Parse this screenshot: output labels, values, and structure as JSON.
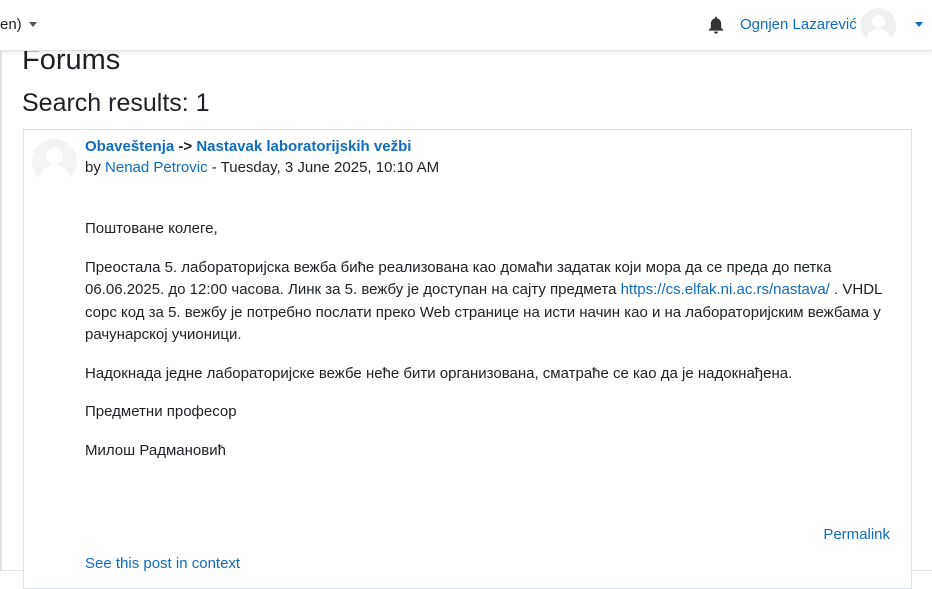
{
  "topbar": {
    "language_label": "en)",
    "user_name": "Ognjen Lazarević"
  },
  "page": {
    "title": "Forums",
    "results_heading": "Search results: 1"
  },
  "post": {
    "forum_link": "Obaveštenja",
    "separator": " -> ",
    "discussion_link": "Nastavak laboratorijskih vežbi",
    "by_prefix": "by ",
    "author": "Nenad Petrovic",
    "date": " - Tuesday, 3 June 2025, 10:10 AM",
    "greeting": "Поштоване колеге,",
    "paragraph1_before_link": "Преостала 5. лабораторијска вежба биће реализована као домаћи задатак који мора да се преда до петка 06.06.2025. до 12:00 часова. Линк за 5. вежбу је доступан на сајту предмета ",
    "paragraph1_link": "https://cs.elfak.ni.ac.rs/nastava/",
    "paragraph1_after_link": " . VHDL сорс код за 5. вежбу је потребно послати преко Web странице на исти начин као и на лабораторијским вежбама у рачунарској учионици.",
    "paragraph2": "Надокнада једне лабораторијске вежбе неће бити организована, сматраће се као да је надокнађена.",
    "signature_role": "Предметни професор",
    "signature_name": "Милош Радмановић",
    "permalink": "Permalink",
    "context_link": "See this post in context"
  }
}
